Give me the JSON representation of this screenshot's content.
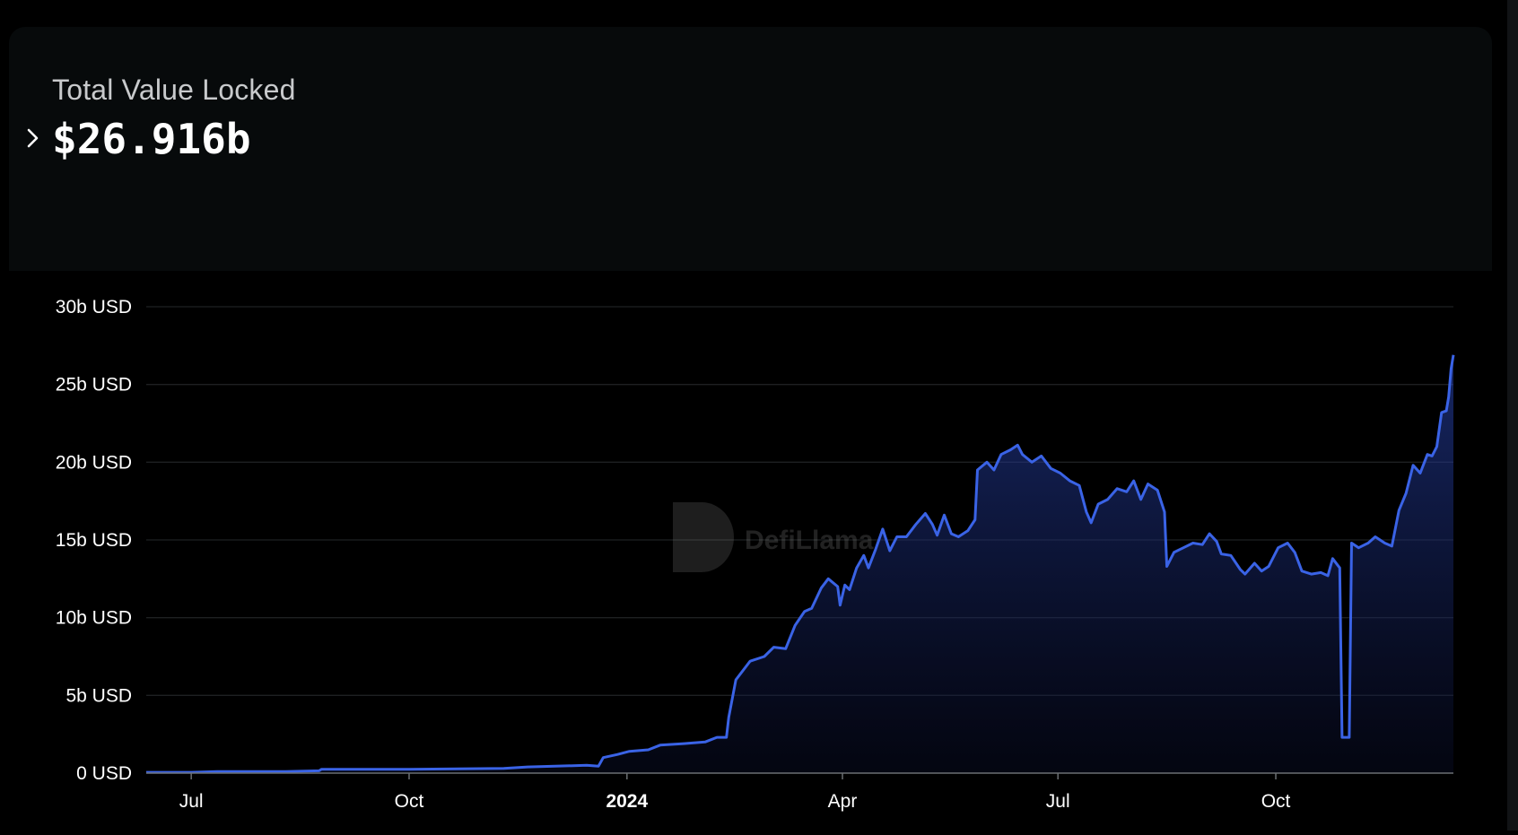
{
  "header": {
    "label": "Total Value Locked",
    "value": "$26.916b"
  },
  "watermark": {
    "text": "DefiLlama"
  },
  "colors": {
    "line": "#3a63e6",
    "grid": "#1e2022",
    "axis": "#9aa0a6",
    "text": "#ffffff",
    "card": "#070a0b"
  },
  "chart_data": {
    "type": "area",
    "title": "",
    "xlabel": "",
    "ylabel": "",
    "ylim": [
      0,
      30
    ],
    "y_ticks": [
      0,
      5,
      10,
      15,
      20,
      25,
      30
    ],
    "y_tick_labels": [
      "0 USD",
      "5b USD",
      "10b USD",
      "15b USD",
      "20b USD",
      "25b USD",
      "30b USD"
    ],
    "x_tick_labels": [
      "Jul",
      "Oct",
      "2024",
      "Apr",
      "Jul",
      "Oct"
    ],
    "x_tick_dates": [
      "2023-07-01",
      "2023-10-01",
      "2024-01-01",
      "2024-04-01",
      "2024-07-01",
      "2024-10-01"
    ],
    "x_range": [
      "2023-06-12",
      "2024-12-15"
    ],
    "grid": true,
    "legend": "none",
    "series": [
      {
        "unit": "b USD",
        "points": [
          [
            "2023-06-12",
            0.05
          ],
          [
            "2023-07-01",
            0.05
          ],
          [
            "2023-07-12",
            0.1
          ],
          [
            "2023-08-10",
            0.1
          ],
          [
            "2023-08-24",
            0.15
          ],
          [
            "2023-08-25",
            0.25
          ],
          [
            "2023-10-01",
            0.25
          ],
          [
            "2023-11-10",
            0.3
          ],
          [
            "2023-11-20",
            0.4
          ],
          [
            "2023-12-15",
            0.5
          ],
          [
            "2023-12-20",
            0.45
          ],
          [
            "2023-12-22",
            1.0
          ],
          [
            "2023-12-28",
            1.2
          ],
          [
            "2024-01-02",
            1.4
          ],
          [
            "2024-01-10",
            1.5
          ],
          [
            "2024-01-15",
            1.8
          ],
          [
            "2024-01-25",
            1.9
          ],
          [
            "2024-02-03",
            2.0
          ],
          [
            "2024-02-08",
            2.3
          ],
          [
            "2024-02-12",
            2.3
          ],
          [
            "2024-02-13",
            3.6
          ],
          [
            "2024-02-16",
            6.0
          ],
          [
            "2024-02-22",
            7.2
          ],
          [
            "2024-02-28",
            7.5
          ],
          [
            "2024-03-03",
            8.1
          ],
          [
            "2024-03-08",
            8.0
          ],
          [
            "2024-03-12",
            9.5
          ],
          [
            "2024-03-16",
            10.4
          ],
          [
            "2024-03-19",
            10.6
          ],
          [
            "2024-03-23",
            11.9
          ],
          [
            "2024-03-26",
            12.5
          ],
          [
            "2024-03-30",
            12.0
          ],
          [
            "2024-03-31",
            10.8
          ],
          [
            "2024-04-02",
            12.1
          ],
          [
            "2024-04-04",
            11.8
          ],
          [
            "2024-04-07",
            13.2
          ],
          [
            "2024-04-10",
            14.0
          ],
          [
            "2024-04-12",
            13.2
          ],
          [
            "2024-04-15",
            14.4
          ],
          [
            "2024-04-18",
            15.7
          ],
          [
            "2024-04-21",
            14.3
          ],
          [
            "2024-04-24",
            15.2
          ],
          [
            "2024-04-28",
            15.2
          ],
          [
            "2024-05-02",
            16.0
          ],
          [
            "2024-05-06",
            16.7
          ],
          [
            "2024-05-09",
            16.0
          ],
          [
            "2024-05-11",
            15.3
          ],
          [
            "2024-05-14",
            16.6
          ],
          [
            "2024-05-17",
            15.4
          ],
          [
            "2024-05-20",
            15.2
          ],
          [
            "2024-05-24",
            15.6
          ],
          [
            "2024-05-27",
            16.3
          ],
          [
            "2024-05-28",
            19.5
          ],
          [
            "2024-06-01",
            20.0
          ],
          [
            "2024-06-04",
            19.5
          ],
          [
            "2024-06-07",
            20.5
          ],
          [
            "2024-06-11",
            20.8
          ],
          [
            "2024-06-14",
            21.1
          ],
          [
            "2024-06-16",
            20.5
          ],
          [
            "2024-06-20",
            20.0
          ],
          [
            "2024-06-24",
            20.4
          ],
          [
            "2024-06-28",
            19.6
          ],
          [
            "2024-07-02",
            19.3
          ],
          [
            "2024-07-06",
            18.8
          ],
          [
            "2024-07-10",
            18.5
          ],
          [
            "2024-07-13",
            16.8
          ],
          [
            "2024-07-15",
            16.1
          ],
          [
            "2024-07-18",
            17.3
          ],
          [
            "2024-07-22",
            17.6
          ],
          [
            "2024-07-26",
            18.3
          ],
          [
            "2024-07-30",
            18.1
          ],
          [
            "2024-08-02",
            18.8
          ],
          [
            "2024-08-05",
            17.6
          ],
          [
            "2024-08-08",
            18.6
          ],
          [
            "2024-08-12",
            18.2
          ],
          [
            "2024-08-15",
            16.8
          ],
          [
            "2024-08-16",
            13.3
          ],
          [
            "2024-08-19",
            14.2
          ],
          [
            "2024-08-23",
            14.5
          ],
          [
            "2024-08-27",
            14.8
          ],
          [
            "2024-08-31",
            14.7
          ],
          [
            "2024-09-03",
            15.4
          ],
          [
            "2024-09-06",
            14.9
          ],
          [
            "2024-09-08",
            14.1
          ],
          [
            "2024-09-12",
            14.0
          ],
          [
            "2024-09-16",
            13.1
          ],
          [
            "2024-09-18",
            12.8
          ],
          [
            "2024-09-22",
            13.5
          ],
          [
            "2024-09-25",
            13.0
          ],
          [
            "2024-09-28",
            13.3
          ],
          [
            "2024-10-02",
            14.5
          ],
          [
            "2024-10-06",
            14.8
          ],
          [
            "2024-10-09",
            14.2
          ],
          [
            "2024-10-12",
            13.0
          ],
          [
            "2024-10-16",
            12.8
          ],
          [
            "2024-10-20",
            12.9
          ],
          [
            "2024-10-23",
            12.7
          ],
          [
            "2024-10-25",
            13.8
          ],
          [
            "2024-10-28",
            13.2
          ],
          [
            "2024-10-29",
            2.3
          ],
          [
            "2024-11-01",
            2.3
          ],
          [
            "2024-11-02",
            14.8
          ],
          [
            "2024-11-05",
            14.5
          ],
          [
            "2024-11-09",
            14.8
          ],
          [
            "2024-11-12",
            15.2
          ],
          [
            "2024-11-16",
            14.8
          ],
          [
            "2024-11-19",
            14.6
          ],
          [
            "2024-11-22",
            16.9
          ],
          [
            "2024-11-25",
            18.0
          ],
          [
            "2024-11-28",
            19.8
          ],
          [
            "2024-12-01",
            19.3
          ],
          [
            "2024-12-04",
            20.5
          ],
          [
            "2024-12-06",
            20.4
          ],
          [
            "2024-12-08",
            21.0
          ],
          [
            "2024-12-10",
            23.2
          ],
          [
            "2024-12-12",
            23.3
          ],
          [
            "2024-12-13",
            24.2
          ],
          [
            "2024-12-14",
            26.0
          ],
          [
            "2024-12-15",
            26.9
          ]
        ]
      }
    ]
  }
}
